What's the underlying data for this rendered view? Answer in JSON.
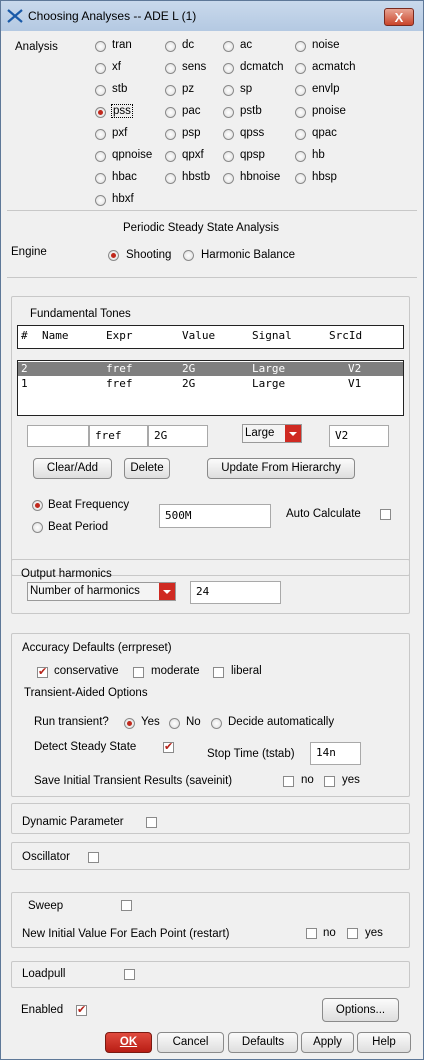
{
  "window": {
    "title": "Choosing Analyses -- ADE L (1)",
    "close_label": "X"
  },
  "analysis": {
    "label": "Analysis",
    "options": [
      "tran",
      "dc",
      "ac",
      "noise",
      "xf",
      "sens",
      "dcmatch",
      "acmatch",
      "stb",
      "pz",
      "sp",
      "envlp",
      "pss",
      "pac",
      "pstb",
      "pnoise",
      "pxf",
      "psp",
      "qpss",
      "qpac",
      "qpnoise",
      "qpxf",
      "qpsp",
      "hb",
      "hbac",
      "hbstb",
      "hbnoise",
      "hbsp",
      "hbxf"
    ],
    "selected": "pss"
  },
  "pss_section": {
    "heading": "Periodic Steady State Analysis",
    "engine_label": "Engine",
    "engine_options": [
      "Shooting",
      "Harmonic Balance"
    ],
    "engine_selected": "Shooting"
  },
  "fundamental_tones": {
    "title": "Fundamental Tones",
    "headers": [
      "#",
      "Name",
      "Expr",
      "Value",
      "Signal",
      "SrcId"
    ],
    "rows": [
      {
        "num": "2",
        "name": "",
        "expr": "fref",
        "value": "2G",
        "signal": "Large",
        "srcid": "V2",
        "selected": true
      },
      {
        "num": "1",
        "name": "",
        "expr": "fref",
        "value": "2G",
        "signal": "Large",
        "srcid": "V1",
        "selected": false
      }
    ],
    "edit_name": "",
    "edit_expr": "fref",
    "edit_value": "2G",
    "edit_signal": "Large",
    "edit_srcid": "V2",
    "buttons": {
      "clear_add": "Clear/Add",
      "delete": "Delete",
      "update": "Update From Hierarchy"
    },
    "beat_frequency_label": "Beat Frequency",
    "beat_period_label": "Beat Period",
    "beat_selected": "Beat Frequency",
    "beat_value": "500M",
    "auto_calculate_label": "Auto Calculate",
    "auto_calculate": false
  },
  "output_harmonics": {
    "title": "Output harmonics",
    "mode": "Number of harmonics",
    "value": "24"
  },
  "accuracy": {
    "title": "Accuracy Defaults (errpreset)",
    "options": [
      "conservative",
      "moderate",
      "liberal"
    ],
    "checked": [
      "conservative"
    ],
    "transient_title": "Transient-Aided Options",
    "run_transient_label": "Run transient?",
    "run_transient_options": [
      "Yes",
      "No",
      "Decide automatically"
    ],
    "run_transient_selected": "Yes",
    "detect_steady_label": "Detect Steady State",
    "detect_steady": true,
    "stop_time_label": "Stop Time (tstab)",
    "stop_time_value": "14n",
    "save_initial_label": "Save Initial Transient Results (saveinit)",
    "save_no": "no",
    "save_yes": "yes"
  },
  "dynamic_parameter": {
    "label": "Dynamic Parameter",
    "checked": false
  },
  "oscillator": {
    "label": "Oscillator",
    "checked": false
  },
  "sweep": {
    "label": "Sweep",
    "checked": false,
    "restart_label": "New Initial Value For Each Point (restart)",
    "restart_no": "no",
    "restart_yes": "yes"
  },
  "loadpull": {
    "label": "Loadpull",
    "checked": false
  },
  "enabled": {
    "label": "Enabled",
    "checked": true
  },
  "buttons": {
    "options": "Options...",
    "ok": "OK",
    "cancel": "Cancel",
    "defaults": "Defaults",
    "apply": "Apply",
    "help": "Help"
  },
  "colors": {
    "accent": "#cf2a22",
    "selection": "#7f7f7f"
  }
}
